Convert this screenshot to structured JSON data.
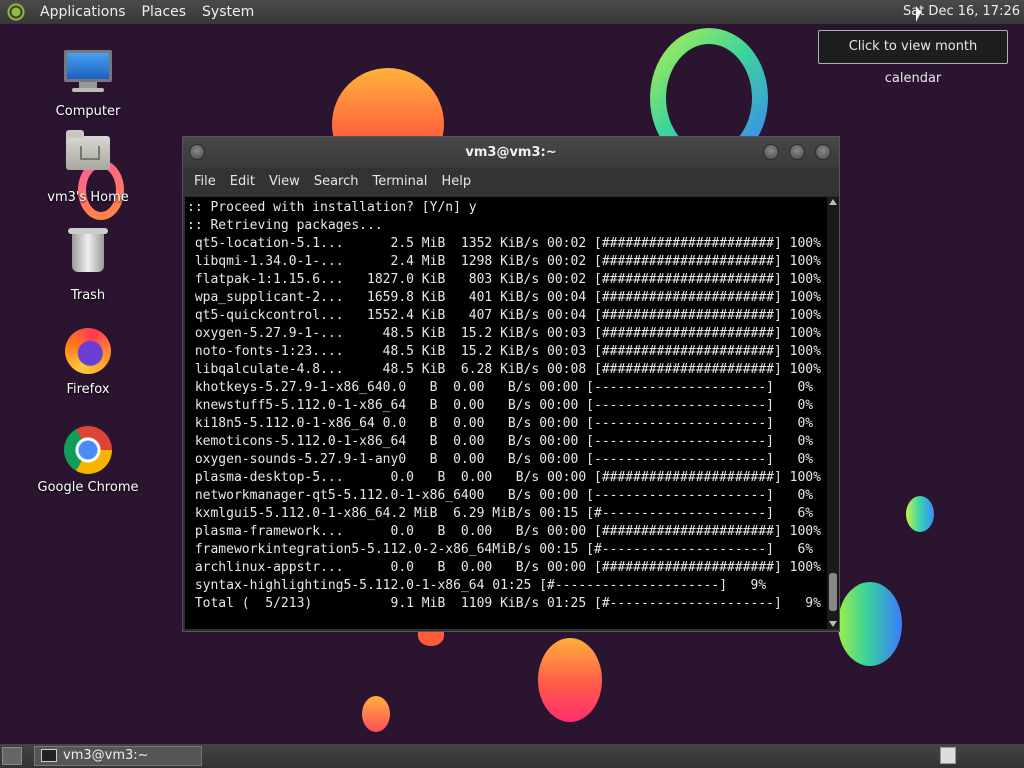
{
  "top_panel": {
    "menus": [
      "Applications",
      "Places",
      "System"
    ],
    "clock": "Sat Dec 16, 17:26"
  },
  "tooltip": "Click to view month calendar",
  "desktop_icons": [
    {
      "label": "Computer",
      "icon": "computer-icon"
    },
    {
      "label": "vm3's Home",
      "icon": "home-folder-icon"
    },
    {
      "label": "Trash",
      "icon": "trash-icon"
    },
    {
      "label": "Firefox",
      "icon": "firefox-icon"
    },
    {
      "label": "Google Chrome",
      "icon": "chrome-icon"
    }
  ],
  "terminal": {
    "title": "vm3@vm3:~",
    "menu": [
      "File",
      "Edit",
      "View",
      "Search",
      "Terminal",
      "Help"
    ],
    "lines": [
      ":: Proceed with installation? [Y/n] y",
      ":: Retrieving packages...",
      " qt5-location-5.1...      2.5 MiB  1352 KiB/s 00:02 [######################] 100%",
      " libqmi-1.34.0-1-...      2.4 MiB  1298 KiB/s 00:02 [######################] 100%",
      " flatpak-1:1.15.6...   1827.0 KiB   803 KiB/s 00:02 [######################] 100%",
      " wpa_supplicant-2...   1659.8 KiB   401 KiB/s 00:04 [######################] 100%",
      " qt5-quickcontrol...   1552.4 KiB   407 KiB/s 00:04 [######################] 100%",
      " oxygen-5.27.9-1-...     48.5 KiB  15.2 KiB/s 00:03 [######################] 100%",
      " noto-fonts-1:23....     48.5 KiB  15.2 KiB/s 00:03 [######################] 100%",
      " libqalculate-4.8...     48.5 KiB  6.28 KiB/s 00:08 [######################] 100%",
      " khotkeys-5.27.9-1-x86_640.0   B  0.00   B/s 00:00 [----------------------]   0%",
      " knewstuff5-5.112.0-1-x86_64   B  0.00   B/s 00:00 [----------------------]   0%",
      " ki18n5-5.112.0-1-x86_64 0.0   B  0.00   B/s 00:00 [----------------------]   0%",
      " kemoticons-5.112.0-1-x86_64   B  0.00   B/s 00:00 [----------------------]   0%",
      " oxygen-sounds-5.27.9-1-any0   B  0.00   B/s 00:00 [----------------------]   0%",
      " plasma-desktop-5...      0.0   B  0.00   B/s 00:00 [######################] 100%",
      " networkmanager-qt5-5.112.0-1-x86_6400   B/s 00:00 [----------------------]   0%",
      " kxmlgui5-5.112.0-1-x86_64.2 MiB  6.29 MiB/s 00:15 [#---------------------]   6%",
      " plasma-framework...      0.0   B  0.00   B/s 00:00 [######################] 100%",
      " frameworkintegration5-5.112.0-2-x86_64MiB/s 00:15 [#---------------------]   6%",
      " archlinux-appstr...      0.0   B  0.00   B/s 00:00 [######################] 100%",
      " syntax-highlighting5-5.112.0-1-x86_64 01:25 [#---------------------]   9%",
      " Total (  5/213)          9.1 MiB  1109 KiB/s 01:25 [#---------------------]   9%"
    ]
  },
  "taskbar": {
    "window_button": "vm3@vm3:~"
  }
}
